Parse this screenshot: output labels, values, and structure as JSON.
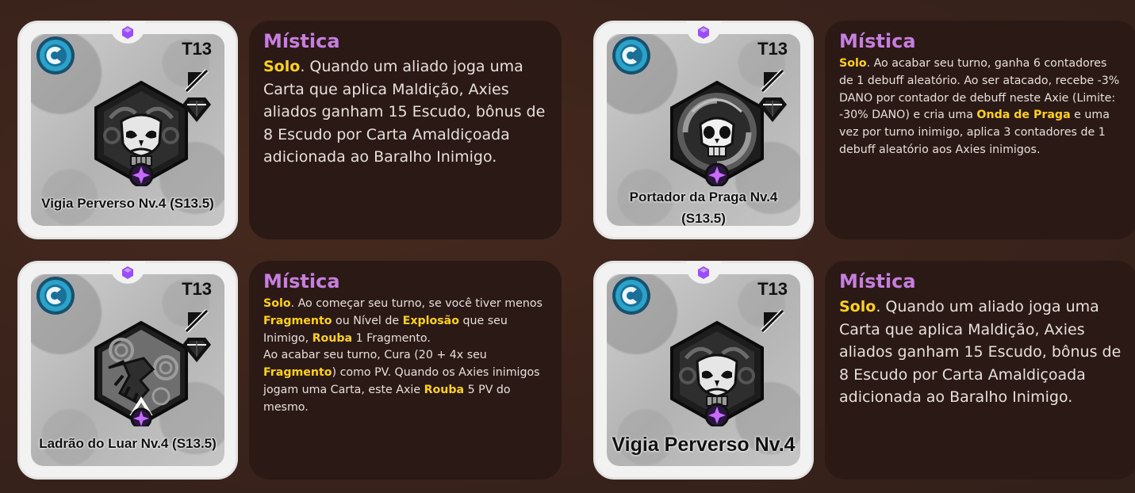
{
  "cards": [
    {
      "tier": "T13",
      "name": "Vigia Perverso Nv.4 (S13.5)",
      "portrait": "sad-skull-icon",
      "show_cost_icon": true,
      "name_size": "large",
      "panel_title": "Mística",
      "text_size": "large",
      "desc": [
        {
          "t": "Solo",
          "hl": true
        },
        {
          "t": ". Quando um aliado joga uma Carta que aplica Maldição, Axies aliados ganham 15 Escudo, bônus de 8 Escudo por Carta Amaldiçoada adicionada ao Baralho Inimigo."
        }
      ]
    },
    {
      "tier": "T13",
      "name": "Portador da Praga Nv.4 (S13.5)",
      "portrait": "plague-skull-icon",
      "show_cost_icon": true,
      "name_size": "wrap",
      "panel_title": "Mística",
      "text_size": "small",
      "desc": [
        {
          "t": "Solo",
          "hl": true
        },
        {
          "t": ". Ao acabar seu turno, ganha 6 contadores de 1 debuff aleatório. Ao ser atacado, recebe -3% DANO por contador de debuff neste Axie (Limite: -30% DANO) e cria uma "
        },
        {
          "t": "Onda de Praga",
          "hl": true
        },
        {
          "t": " e uma vez por turno inimigo, aplica 3 contadores de 1 debuff aleatório aos Axies inimigos."
        }
      ]
    },
    {
      "tier": "T13",
      "name": "Ladrão do Luar Nv.4 (S13.5)",
      "portrait": "moon-thief-icon",
      "show_cost_icon": true,
      "name_size": "large",
      "panel_title": "Mística",
      "text_size": "small",
      "desc": [
        {
          "t": "Solo",
          "hl": true
        },
        {
          "t": ". Ao começar seu turno, se você tiver menos "
        },
        {
          "t": "Fragmento",
          "hl": true
        },
        {
          "t": " ou Nível de "
        },
        {
          "t": "Explosão",
          "hl": true
        },
        {
          "t": " que seu Inimigo, "
        },
        {
          "t": "Rouba",
          "hl": true
        },
        {
          "t": " 1 Fragmento.\nAo acabar seu turno, Cura (20 + 4x seu "
        },
        {
          "t": "Fragmento",
          "hl": true
        },
        {
          "t": ") como PV. Quando os Axies inimigos jogam uma Carta, este Axie "
        },
        {
          "t": "Rouba",
          "hl": true
        },
        {
          "t": " 5 PV do mesmo."
        }
      ]
    },
    {
      "tier": "T13",
      "name": "Vigia Perverso Nv.4",
      "portrait": "sad-skull-icon",
      "show_cost_icon": false,
      "name_size": "xlarge",
      "panel_title": "Mística",
      "text_size": "large",
      "desc": [
        {
          "t": "Solo",
          "hl": true
        },
        {
          "t": ". Quando um aliado joga uma Carta que aplica Maldição, Axies aliados ganham 15 Escudo, bônus de 8 Escudo por Carta Amaldiçoada adicionada ao Baralho Inimigo."
        }
      ]
    }
  ],
  "colors": {
    "accent_title": "#c77ee0",
    "highlight": "#ffd21a",
    "panel_bg": "#2b1915",
    "page_bg": "#3a231b",
    "mystic_purple": "#9b4dff"
  }
}
